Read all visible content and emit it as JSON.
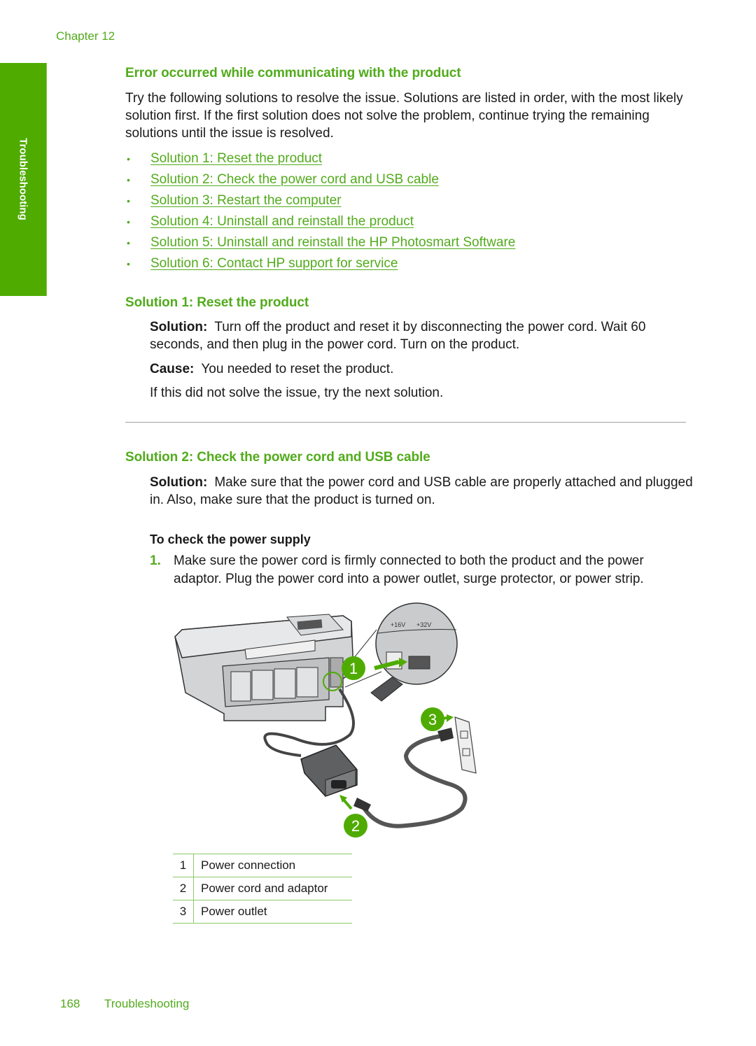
{
  "header": {
    "chapter": "Chapter 12"
  },
  "side_tab": {
    "label": "Troubleshooting"
  },
  "section": {
    "title": "Error occurred while communicating with the product",
    "intro": "Try the following solutions to resolve the issue. Solutions are listed in order, with the most likely solution first. If the first solution does not solve the problem, continue trying the remaining solutions until the issue is resolved.",
    "links": [
      {
        "label": "Solution 1: Reset the product"
      },
      {
        "label": "Solution 2: Check the power cord and USB cable"
      },
      {
        "label": "Solution 3: Restart the computer"
      },
      {
        "label": "Solution 4: Uninstall and reinstall the product"
      },
      {
        "label": "Solution 5: Uninstall and reinstall the HP Photosmart Software"
      },
      {
        "label": "Solution 6: Contact HP support for service"
      }
    ]
  },
  "solution1": {
    "title": "Solution 1: Reset the product",
    "solution_label": "Solution:",
    "solution_text": "Turn off the product and reset it by disconnecting the power cord. Wait 60 seconds, and then plug in the power cord. Turn on the product.",
    "cause_label": "Cause:",
    "cause_text": "You needed to reset the product.",
    "next": "If this did not solve the issue, try the next solution."
  },
  "solution2": {
    "title": "Solution 2: Check the power cord and USB cable",
    "solution_label": "Solution:",
    "solution_text": "Make sure that the power cord and USB cable are properly attached and plugged in. Also, make sure that the product is turned on.",
    "procedure_title": "To check the power supply",
    "steps": [
      {
        "num": "1.",
        "text": "Make sure the power cord is firmly connected to both the product and the power adaptor. Plug the power cord into a power outlet, surge protector, or power strip."
      }
    ]
  },
  "illustration": {
    "callouts": [
      "1",
      "2",
      "3"
    ],
    "port_labels": [
      "+16V",
      "+32V"
    ],
    "accent_color": "#4fab00"
  },
  "legend": [
    {
      "num": "1",
      "text": "Power connection"
    },
    {
      "num": "2",
      "text": "Power cord and adaptor"
    },
    {
      "num": "3",
      "text": "Power outlet"
    }
  ],
  "footer": {
    "page": "168",
    "section": "Troubleshooting"
  }
}
